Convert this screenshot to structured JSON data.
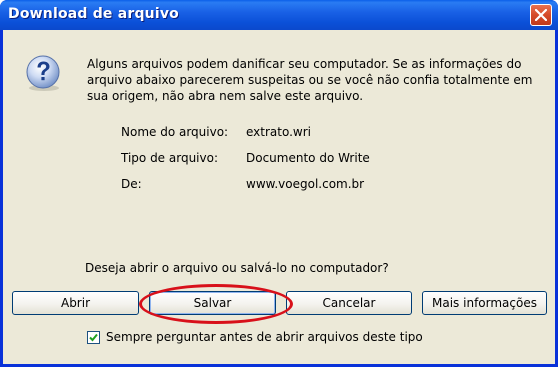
{
  "window": {
    "title": "Download de arquivo",
    "close_icon": "close-icon"
  },
  "dialog": {
    "icon": "question-mark-icon",
    "warning_text": "Alguns arquivos podem danificar seu computador. Se as informações do arquivo abaixo parecerem suspeitas ou se você não confia totalmente em sua origem, não abra nem salve este arquivo.",
    "file_info": [
      {
        "label": "Nome do arquivo:",
        "value": "extrato.wri"
      },
      {
        "label": "Tipo de arquivo:",
        "value": "Documento do Write"
      },
      {
        "label": "De:",
        "value": "www.voegol.com.br"
      }
    ],
    "question": "Deseja abrir o arquivo ou salvá-lo no computador?",
    "buttons": {
      "open": "Abrir",
      "save": "Salvar",
      "cancel": "Cancelar",
      "more_info": "Mais informações"
    },
    "always_ask": {
      "label": "Sempre perguntar antes de abrir arquivos deste tipo",
      "checked": true
    }
  },
  "colors": {
    "titlebar": "#0b50d8",
    "client_bg": "#ece9d8",
    "close_button": "#d54a28",
    "highlight": "#d8101a"
  }
}
